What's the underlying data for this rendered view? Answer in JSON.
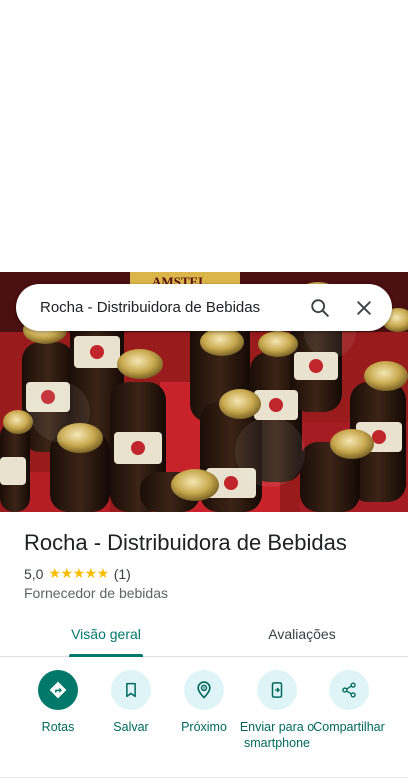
{
  "search": {
    "value": "Rocha - Distribuidora de Bebidas",
    "search_icon": "search-icon",
    "close_icon": "close-icon"
  },
  "hero": {
    "description_icon": "photo",
    "label_text": "AMSTEL"
  },
  "place": {
    "title": "Rocha - Distribuidora de Bebidas",
    "rating": "5,0",
    "stars": "★★★★★",
    "review_count": "(1)",
    "category": "Fornecedor de bebidas"
  },
  "tabs": [
    {
      "label": "Visão geral",
      "selected": true
    },
    {
      "label": "Avaliações",
      "selected": false
    }
  ],
  "actions": [
    {
      "label": "Rotas",
      "icon": "directions-icon"
    },
    {
      "label": "Salvar",
      "icon": "bookmark-icon"
    },
    {
      "label": "Próximo",
      "icon": "nearby-icon"
    },
    {
      "label": "Enviar para o smartphone",
      "icon": "send-to-phone-icon"
    },
    {
      "label": "Compartilhar",
      "icon": "share-icon"
    }
  ],
  "colors": {
    "accent": "#00796b",
    "action_bg": "#dff4f7",
    "star": "#fbbc04"
  }
}
